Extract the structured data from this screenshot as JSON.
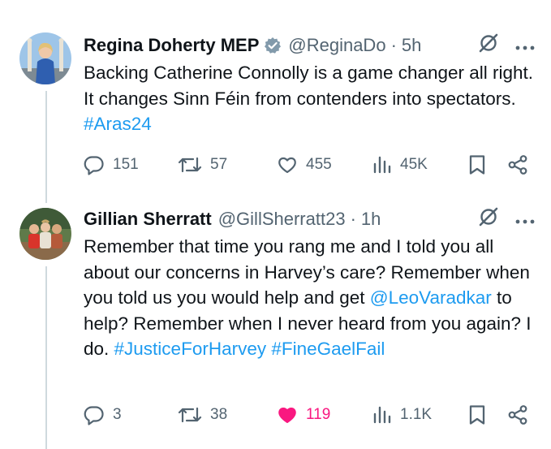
{
  "tweets": [
    {
      "author_name": "Regina Doherty MEP",
      "verified": true,
      "handle": "@ReginaDo",
      "time": "5h",
      "body": [
        {
          "text": "Backing Catherine Connolly is a game changer all right. It changes Sinn Féin from contenders into spectators. ",
          "link": false
        },
        {
          "text": "#Aras24",
          "link": true
        }
      ],
      "stats": {
        "replies": "151",
        "reposts": "57",
        "likes": "455",
        "views": "45K"
      },
      "liked": false
    },
    {
      "author_name": "Gillian Sherratt",
      "verified": false,
      "handle": "@GillSherratt23",
      "time": "1h",
      "body": [
        {
          "text": "Remember that time you rang me and I told you all about our concerns in Harvey’s care? Remember when you told us you would help and get ",
          "link": false
        },
        {
          "text": "@LeoVaradkar",
          "link": true
        },
        {
          "text": " to help? Remember when I never heard from you again? I do. ",
          "link": false
        },
        {
          "text": "#JusticeForHarvey",
          "link": true
        },
        {
          "text": " ",
          "link": false
        },
        {
          "text": "#FineGaelFail",
          "link": true
        }
      ],
      "stats": {
        "replies": "3",
        "reposts": "38",
        "likes": "119",
        "views": "1.1K"
      },
      "liked": true
    }
  ],
  "separator": "·",
  "colors": {
    "accent": "#1d9bf0",
    "muted": "#536471",
    "like": "#f91880",
    "text": "#0f1419",
    "thread_line": "#cfd9de"
  },
  "icons": [
    "verified-badge-icon",
    "grok-icon",
    "more-icon",
    "reply-icon",
    "repost-icon",
    "like-icon",
    "views-icon",
    "bookmark-icon",
    "share-icon"
  ]
}
